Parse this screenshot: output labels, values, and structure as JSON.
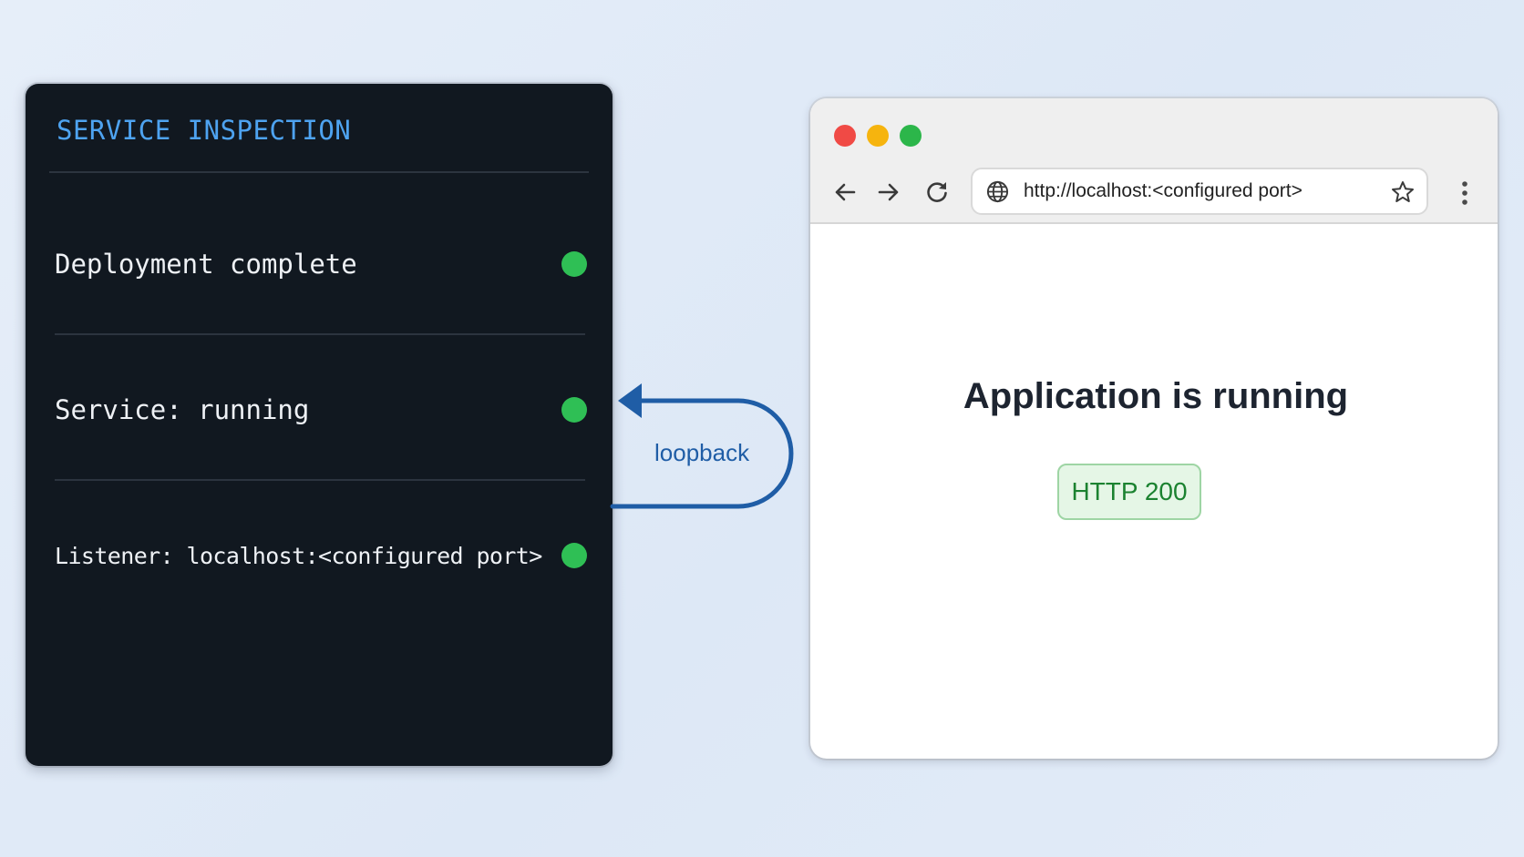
{
  "terminal": {
    "title": "SERVICE INSPECTION",
    "status_items": [
      {
        "label": "Deployment complete",
        "status": "ok"
      },
      {
        "label": "Service: running",
        "status": "ok"
      },
      {
        "label": "Listener: localhost:<configured port>",
        "status": "ok"
      }
    ]
  },
  "connector": {
    "label": "loopback"
  },
  "browser": {
    "url": "http://localhost:<configured port>",
    "heading": "Application is running",
    "status_badge": "HTTP 200"
  },
  "colors": {
    "terminal_bg": "#111820",
    "terminal_title": "#4ea3f0",
    "status_dot": "#2fbf55",
    "loop_arrow": "#1f5da6",
    "badge_text": "#1b8230",
    "badge_bg": "#e5f6e6"
  },
  "icons": {
    "back": "arrow-left",
    "forward": "arrow-right",
    "reload": "reload",
    "site": "globe",
    "bookmark": "star",
    "menu": "kebab-menu"
  }
}
